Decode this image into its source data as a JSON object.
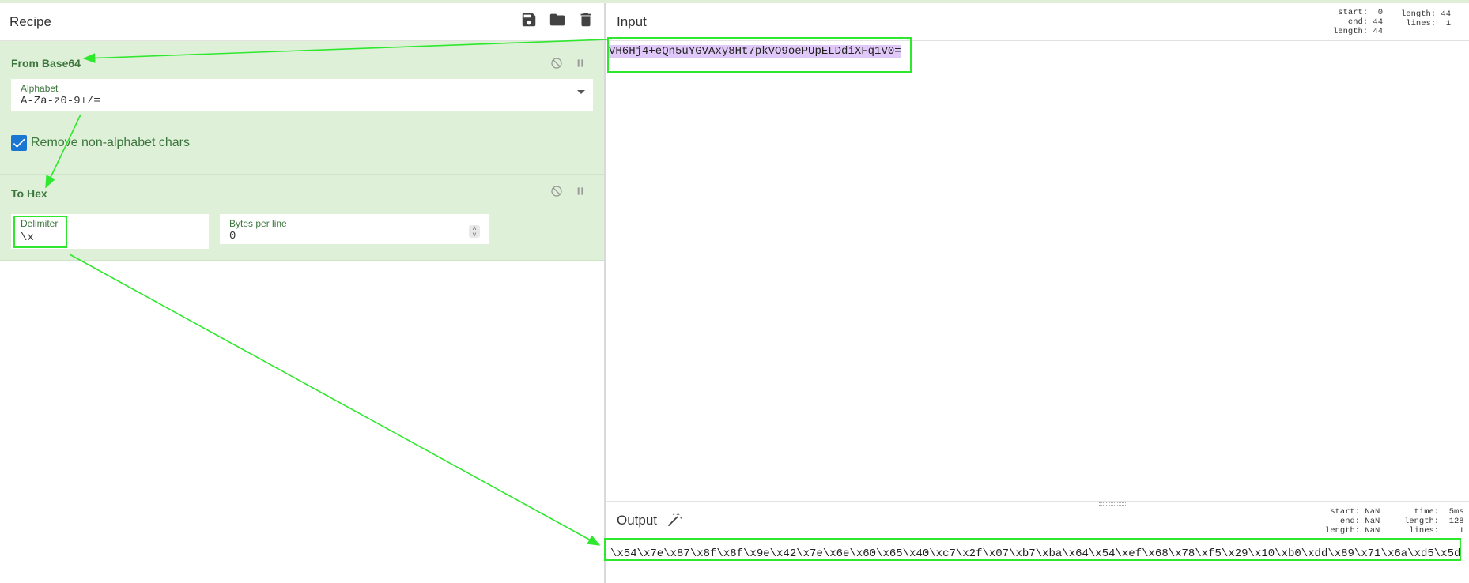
{
  "recipe": {
    "title": "Recipe",
    "icons": [
      "save-icon",
      "folder-open-icon",
      "trash-icon"
    ],
    "operations": [
      {
        "name": "From Base64",
        "alphabet_label": "Alphabet",
        "alphabet_value": "A-Za-z0-9+/=",
        "remove_label": "Remove non-alphabet chars",
        "remove_checked": true
      },
      {
        "name": "To Hex",
        "delimiter_label": "Delimiter",
        "delimiter_value": "\\x",
        "bytes_label": "Bytes per line",
        "bytes_value": "0"
      }
    ]
  },
  "input": {
    "title": "Input",
    "text": "VH6Hj4+eQn5uYGVAxy8Ht7pkVO9oePUpELDdiXFq1V0=",
    "stats_left": "start:  0\n  end: 44\nlength: 44",
    "stats_right": "length: 44\n lines:  1"
  },
  "output": {
    "title": "Output",
    "text": "\\x54\\x7e\\x87\\x8f\\x8f\\x9e\\x42\\x7e\\x6e\\x60\\x65\\x40\\xc7\\x2f\\x07\\xb7\\xba\\x64\\x54\\xef\\x68\\x78\\xf5\\x29\\x10\\xb0\\xdd\\x89\\x71\\x6a\\xd5\\x5d",
    "stats_left": " start: NaN\n   end: NaN\nlength: NaN",
    "stats_right": "  time:  5ms\nlength:  128\n lines:    1"
  },
  "colors": {
    "highlight": "#2ee82e",
    "op_bg": "#dff0d8",
    "label_green": "#3c763d",
    "selection": "#e0c8f8"
  }
}
